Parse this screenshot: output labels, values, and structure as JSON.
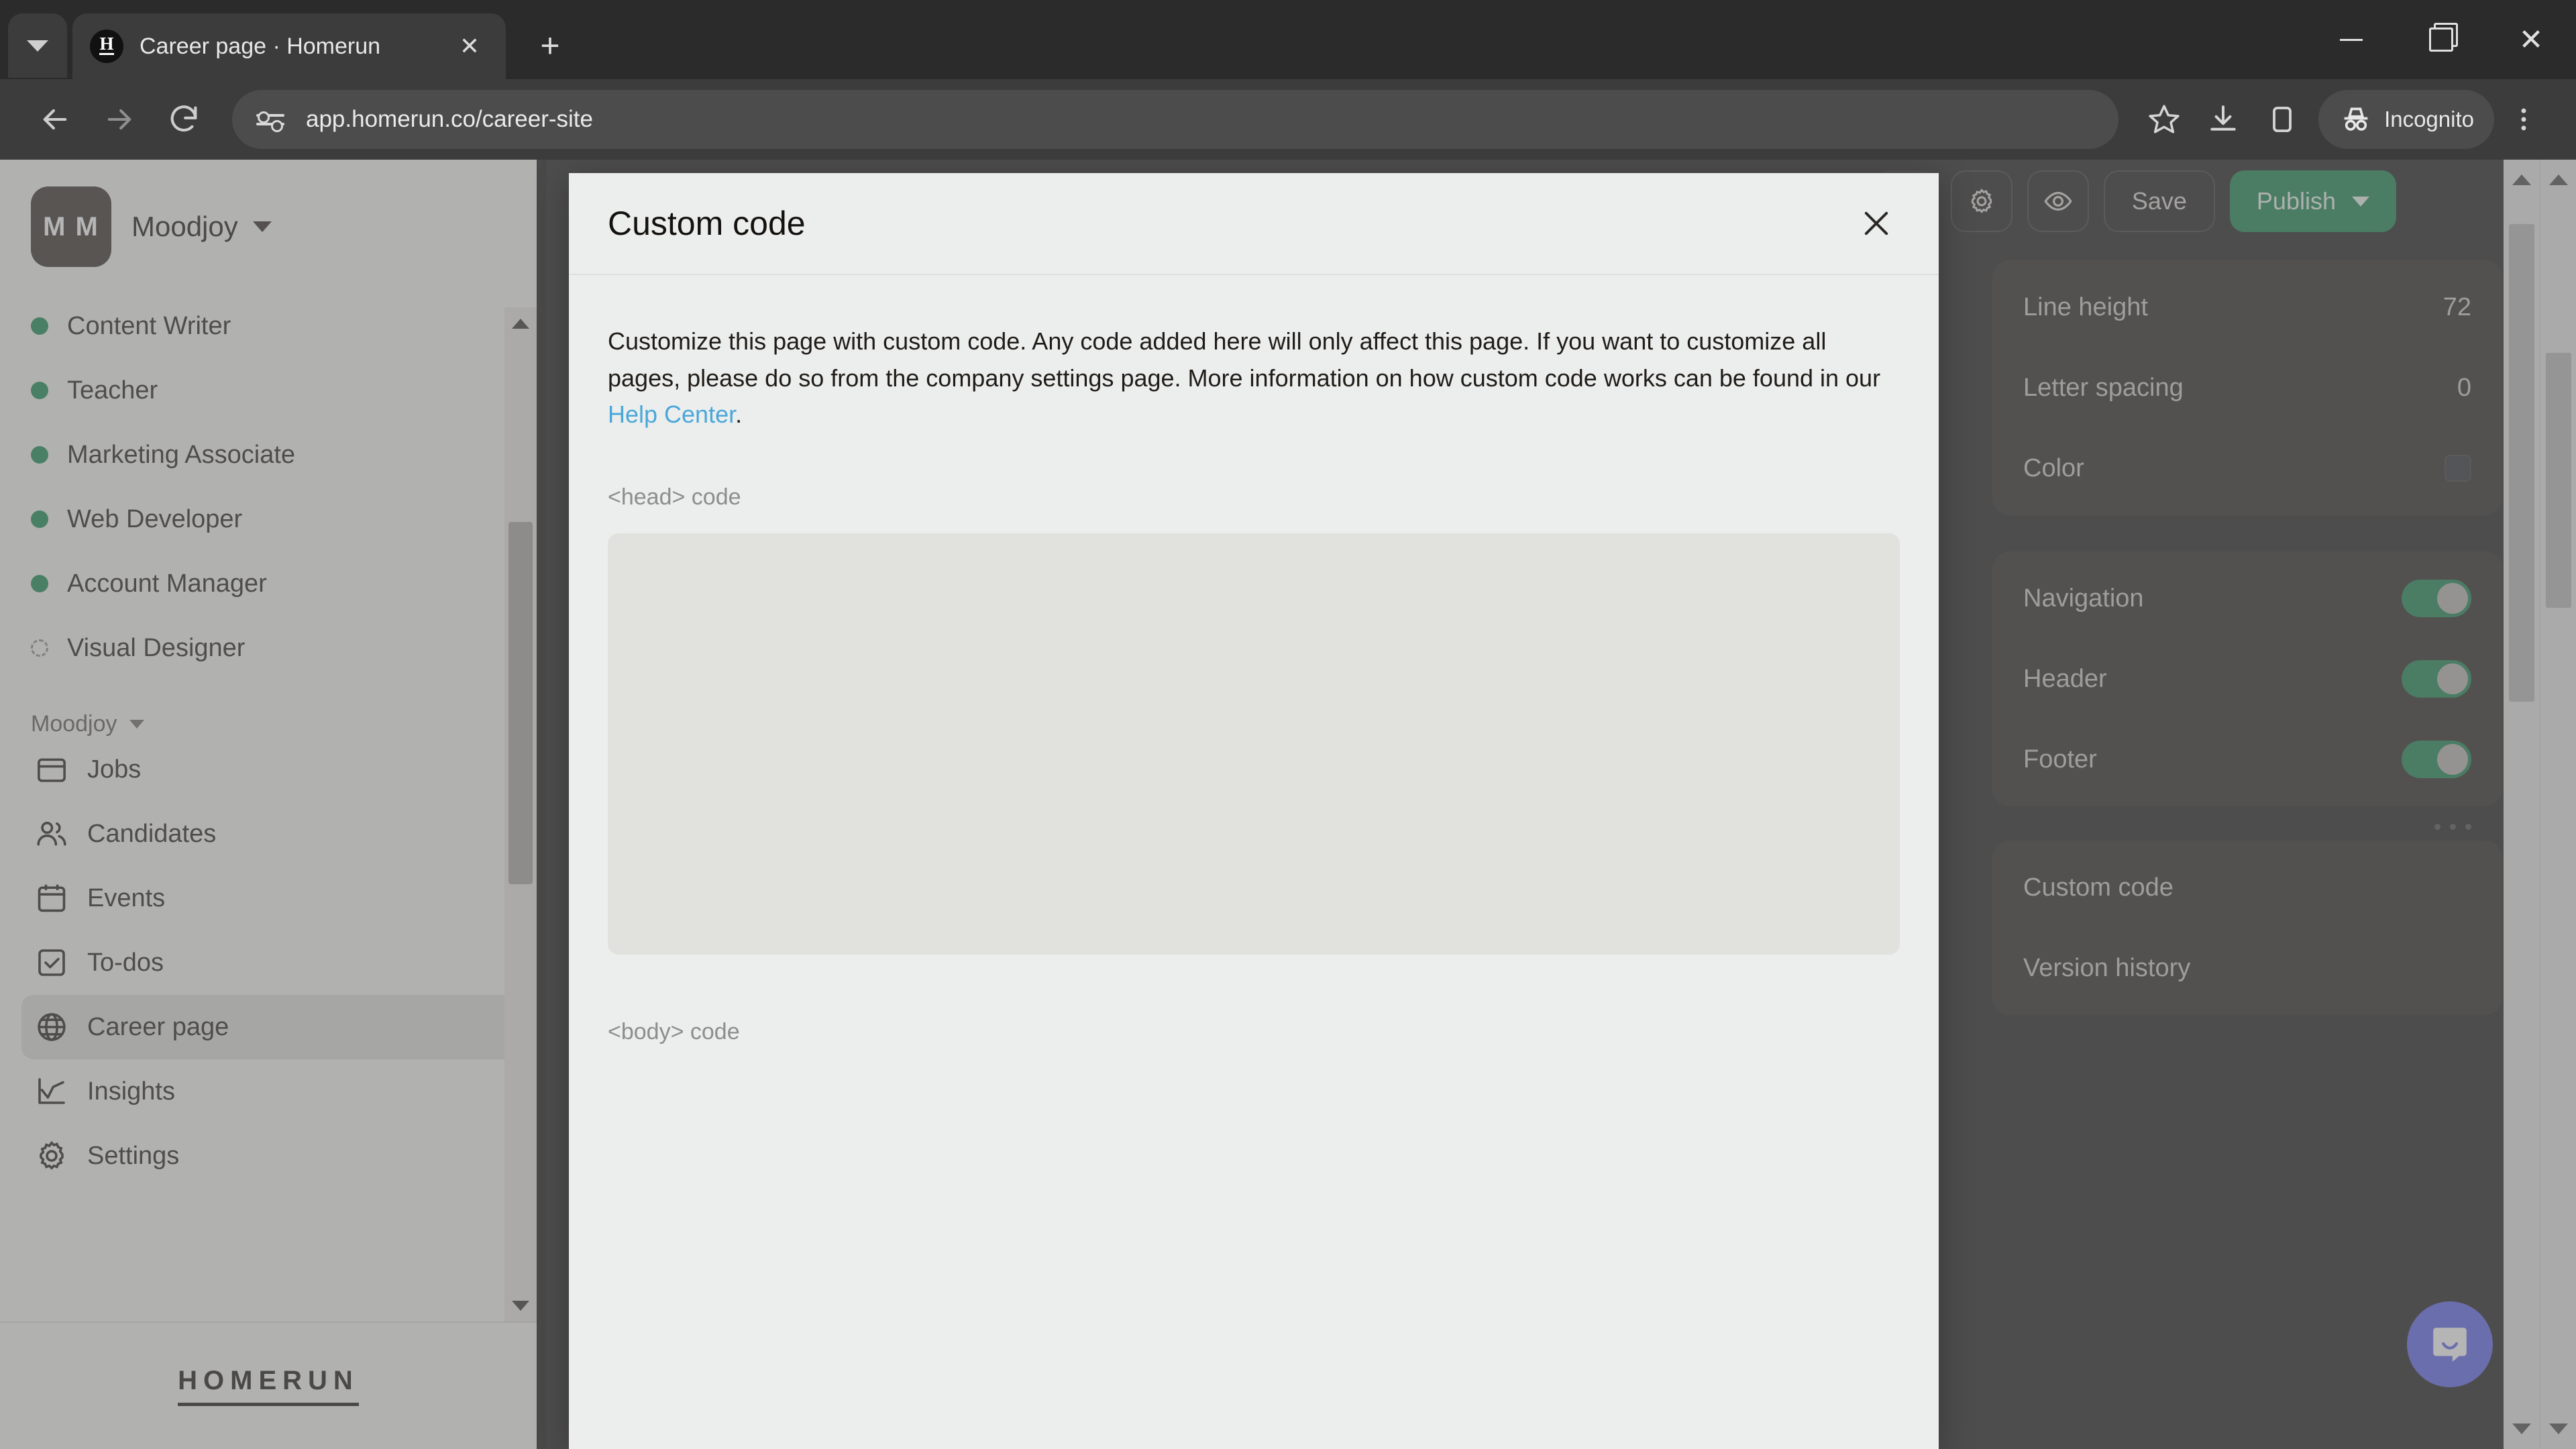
{
  "browser": {
    "tab_search_icon": "chevron-down-icon",
    "tab": {
      "favicon_letter": "H",
      "title": "Career page · Homerun",
      "close_label": "✕"
    },
    "new_tab_label": "+",
    "window_controls": {
      "minimize": "−",
      "maximize": "❐",
      "close": "✕"
    },
    "nav": {
      "back": "←",
      "forward": "→",
      "reload": "⟳"
    },
    "omnibox": {
      "url": "app.homerun.co/career-site",
      "site_info_icon": "site-settings-icon"
    },
    "toolbar": {
      "bookmark_icon": "star-icon",
      "downloads_icon": "download-icon",
      "side_panel_icon": "side-panel-icon",
      "profile_label": "Incognito",
      "profile_icon": "incognito-icon",
      "menu_icon": "three-dot-menu-icon"
    }
  },
  "sidebar": {
    "org": {
      "initials": "M M",
      "name": "Moodjoy"
    },
    "jobs": [
      {
        "label": "Content Writer",
        "status": "published"
      },
      {
        "label": "Teacher",
        "status": "published"
      },
      {
        "label": "Marketing Associate",
        "status": "published"
      },
      {
        "label": "Web Developer",
        "status": "published"
      },
      {
        "label": "Account Manager",
        "status": "published"
      },
      {
        "label": "Visual Designer",
        "status": "draft"
      }
    ],
    "section_label": "Moodjoy",
    "nav": [
      {
        "label": "Jobs",
        "icon": "briefcase-icon",
        "active": false
      },
      {
        "label": "Candidates",
        "icon": "people-icon",
        "active": false
      },
      {
        "label": "Events",
        "icon": "calendar-icon",
        "active": false
      },
      {
        "label": "To-dos",
        "icon": "checkbox-icon",
        "active": false
      },
      {
        "label": "Career page",
        "icon": "globe-icon",
        "active": true
      },
      {
        "label": "Insights",
        "icon": "chart-line-icon",
        "active": false
      },
      {
        "label": "Settings",
        "icon": "gear-icon",
        "active": false
      }
    ],
    "footer_logo": "HOMERUN"
  },
  "editor": {
    "toolbar": {
      "undo_icon": "undo-icon",
      "settings_icon": "gear-icon",
      "preview_icon": "eye-icon",
      "save_label": "Save",
      "publish_label": "Publish",
      "publish_caret_icon": "chevron-down-icon"
    },
    "typography": [
      {
        "label": "Line height",
        "value": "72"
      },
      {
        "label": "Letter spacing",
        "value": "0"
      },
      {
        "label": "Color",
        "value": "",
        "swatch": "#262c33"
      }
    ],
    "sections": [
      {
        "label": "Navigation",
        "enabled": true
      },
      {
        "label": "Header",
        "enabled": true
      },
      {
        "label": "Footer",
        "enabled": true
      }
    ],
    "more_icon": "three-dot-menu-icon",
    "links": [
      {
        "label": "Custom code"
      },
      {
        "label": "Version history"
      }
    ],
    "intercom_icon": "chat-bubble-icon",
    "accent_color": "#15824c"
  },
  "modal": {
    "title": "Custom code",
    "close_icon": "close-icon",
    "description_before": "Customize this page with custom code. Any code added here will only affect this page. If you want to customize all pages, please do so from the company settings page. More information on how custom code works can be found in our ",
    "link_label": "Help Center",
    "description_after": ".",
    "head_field_label": "<head> code",
    "head_field_value": "",
    "body_field_label": "<body> code",
    "body_field_value": ""
  }
}
